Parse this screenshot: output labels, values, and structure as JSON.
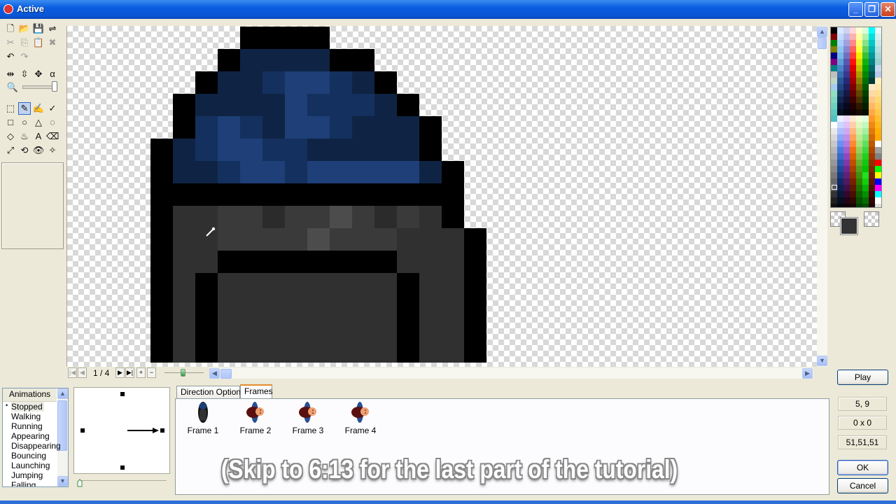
{
  "window": {
    "title": "Active",
    "controls": {
      "minimize": "_",
      "restore": "❐",
      "close": "✕"
    }
  },
  "toolbar": {
    "rows": [
      [
        {
          "name": "new-file-icon",
          "glyph": "🗋",
          "enabled": true
        },
        {
          "name": "open-folder-icon",
          "glyph": "📂",
          "enabled": true
        },
        {
          "name": "save-icon",
          "glyph": "💾",
          "enabled": true
        },
        {
          "name": "import-export-icon",
          "glyph": "⇌",
          "enabled": true
        }
      ],
      [
        {
          "name": "cut-icon",
          "glyph": "✂",
          "enabled": false
        },
        {
          "name": "copy-icon",
          "glyph": "⎘",
          "enabled": false
        },
        {
          "name": "paste-icon",
          "glyph": "📋",
          "enabled": false
        },
        {
          "name": "delete-icon",
          "glyph": "✖",
          "enabled": false
        }
      ],
      [
        {
          "name": "undo-icon",
          "glyph": "↶",
          "enabled": true
        },
        {
          "name": "redo-icon",
          "glyph": "↷",
          "enabled": false
        }
      ],
      [
        {
          "name": "flip-horizontal-icon",
          "glyph": "⇹",
          "enabled": true
        },
        {
          "name": "flip-vertical-icon",
          "glyph": "⇳",
          "enabled": true
        },
        {
          "name": "resize-icon",
          "glyph": "✥",
          "enabled": true
        },
        {
          "name": "alpha-icon",
          "glyph": "α",
          "enabled": true
        }
      ],
      [
        {
          "name": "selection-icon",
          "glyph": "⬚",
          "enabled": true
        },
        {
          "name": "color-picker-icon",
          "glyph": "✎",
          "enabled": true,
          "active": true
        },
        {
          "name": "freehand-icon",
          "glyph": "✍",
          "enabled": true
        },
        {
          "name": "line-icon",
          "glyph": "✓",
          "enabled": true
        }
      ],
      [
        {
          "name": "rectangle-icon",
          "glyph": "□",
          "enabled": true
        },
        {
          "name": "ellipse-icon",
          "glyph": "○",
          "enabled": true
        },
        {
          "name": "polygon-icon",
          "glyph": "△",
          "enabled": true
        },
        {
          "name": "lasso-icon",
          "glyph": "◌",
          "enabled": true
        }
      ],
      [
        {
          "name": "fill-bucket-icon",
          "glyph": "◇",
          "enabled": true
        },
        {
          "name": "spray-icon",
          "glyph": "♨",
          "enabled": true
        },
        {
          "name": "text-icon",
          "glyph": "A",
          "enabled": true
        },
        {
          "name": "eraser-icon",
          "glyph": "⌫",
          "enabled": true
        }
      ],
      [
        {
          "name": "resize-arrow-icon",
          "glyph": "⤢",
          "enabled": true
        },
        {
          "name": "rotate-icon",
          "glyph": "⟲",
          "enabled": true
        },
        {
          "name": "eye-icon",
          "glyph": "👁",
          "enabled": true
        },
        {
          "name": "hotspot-icon",
          "glyph": "✧",
          "enabled": true
        }
      ]
    ],
    "zoom_icon": "🔍",
    "zoom_level": 1.0
  },
  "frame_nav": {
    "first": "|◀",
    "prev": "◀",
    "counter": "1 / 4",
    "next": "▶",
    "last": "▶|",
    "add": "+",
    "remove": "−",
    "speed_fraction": 0.45
  },
  "sprite": {
    "colors": {
      "K": "#000000",
      "a": "#0f2444",
      "b": "#14305e",
      "c": "#1e3f78",
      "g": "#303030",
      "h": "#3a3a3a",
      "i": "#424242",
      "j": "#4c4c4c",
      "d": "#2b2b2b"
    },
    "rows": [
      "....KKKK....",
      "...KaaaaKK..",
      "..KaabccbaK.",
      ".KaaaacbbaK.",
      ".KbcbaccbaaK",
      "KabccbbaaaaK",
      "KaabccbcccaaK",
      "KKKKKKKKKKKKK",
      "KgghhdhjhdhgK",
      "KgghhhijhhhgggK",
      "KggKKKKKKKKggK",
      "KgKgggggggKgK",
      "KgKgggggggKgK"
    ]
  },
  "palette": {
    "selected_foreground": "#333333",
    "selected_background": "transparent"
  },
  "readouts": {
    "position": "5, 9",
    "selection_size": "0 x 0",
    "color_rgb": "51,51,51"
  },
  "buttons": {
    "play": "Play",
    "ok": "OK",
    "cancel": "Cancel"
  },
  "animations": {
    "header": "Animations",
    "items": [
      "Stopped",
      "Walking",
      "Running",
      "Appearing",
      "Disappearing",
      "Bouncing",
      "Launching",
      "Jumping",
      "Falling"
    ],
    "selected": 0
  },
  "direction": {
    "arrow": "→",
    "speed_fraction": 0.0
  },
  "tabs": {
    "items": [
      "Direction Options",
      "Frames"
    ],
    "active": 1
  },
  "frames": [
    "Frame 1",
    "Frame 2",
    "Frame 3",
    "Frame 4"
  ],
  "caption": "(Skip to 6:13 for the last part of the tutorial)"
}
